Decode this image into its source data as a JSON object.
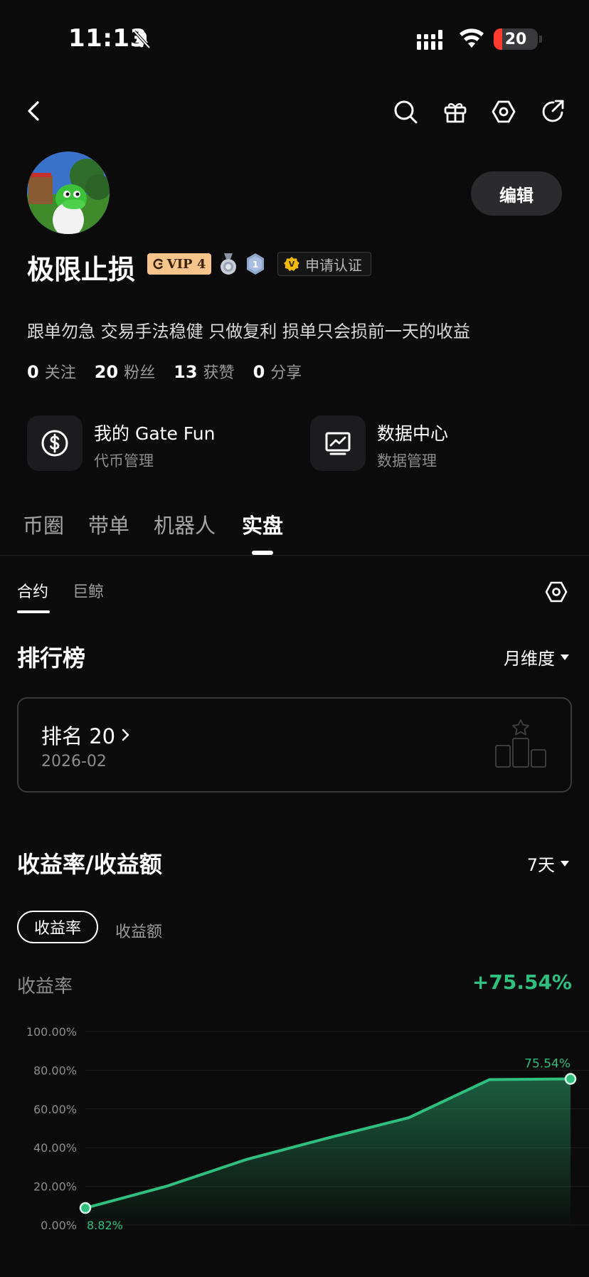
{
  "status_bar": {
    "time": "11:13",
    "battery": "20",
    "battery_level": 0.2
  },
  "profile": {
    "name": "极限止损",
    "vip_label": "VIP 4",
    "medal_level": "1",
    "verify_label": "申请认证",
    "verify_badge": "V",
    "edit_label": "编辑",
    "bio": "跟单勿急 交易手法稳健 只做复利 损单只会损前一天的收益",
    "stats": [
      {
        "num": "0",
        "label": "关注"
      },
      {
        "num": "20",
        "label": "粉丝"
      },
      {
        "num": "13",
        "label": "获赞"
      },
      {
        "num": "0",
        "label": "分享"
      }
    ]
  },
  "cards": [
    {
      "title": "我的 Gate Fun",
      "sub": "代币管理",
      "icon": "dollar-circle-icon"
    },
    {
      "title": "数据中心",
      "sub": "数据管理",
      "icon": "chart-monitor-icon"
    }
  ],
  "main_tabs": [
    "币圈",
    "带单",
    "机器人",
    "实盘"
  ],
  "active_main_tab": "实盘",
  "sub_tabs": [
    "合约",
    "巨鲸"
  ],
  "active_sub_tab": "合约",
  "ranking": {
    "title": "排行榜",
    "period": "月维度",
    "rank_label": "排名 20",
    "date": "2026-02"
  },
  "returns": {
    "title": "收益率/收益额",
    "period": "7天",
    "toggle": [
      "收益率",
      "收益额"
    ],
    "metric_label": "收益率",
    "metric_value": "+75.54%"
  },
  "colors": {
    "accent_green": "#2fbf7f",
    "background": "#0b0b0b",
    "vip_gold": "#f7c48b"
  },
  "chart_data": {
    "type": "area",
    "x": [
      1,
      2,
      3,
      4,
      5,
      6,
      7
    ],
    "series": [
      {
        "values": [
          8.82,
          20.0,
          34.0,
          45.0,
          55.5,
          75.2,
          75.54
        ]
      }
    ],
    "yticks": [
      "0.00%",
      "20.00%",
      "40.00%",
      "60.00%",
      "80.00%",
      "100.00%"
    ],
    "ylim": [
      0,
      100
    ],
    "start_label": "8.82%",
    "end_label": "75.54%",
    "grid": true
  }
}
